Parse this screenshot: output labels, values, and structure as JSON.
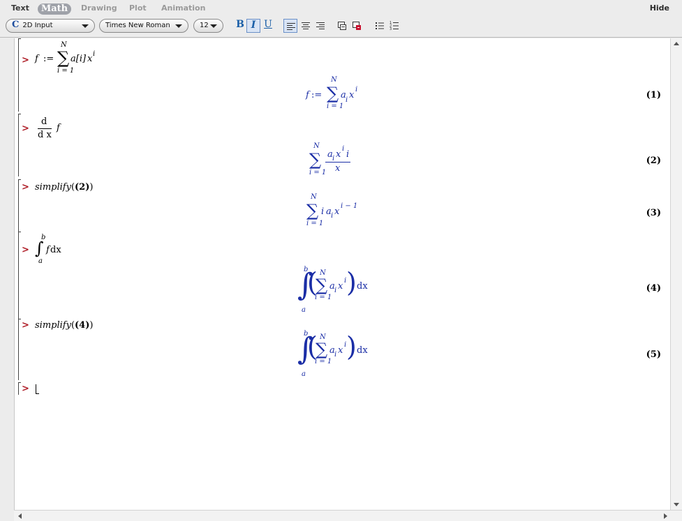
{
  "mode_tabs": {
    "text": "Text",
    "math": "Math",
    "drawing": "Drawing",
    "plot": "Plot",
    "animation": "Animation",
    "hide": "Hide"
  },
  "toolbar": {
    "input_mode": "2D Input",
    "font_family": "Times New Roman",
    "font_size": "12",
    "bold": "B",
    "italic": "I",
    "underline": "U"
  },
  "icons": {
    "input_mode": "math-c-icon",
    "align_left": "align-left-icon",
    "align_center": "align-center-icon",
    "align_right": "align-right-icon",
    "doc1": "insert-region-icon",
    "doc2": "delete-region-icon",
    "bullet_list": "bullet-list-icon",
    "numbered_list": "numbered-list-icon"
  },
  "colors": {
    "prompt": "#b0202a",
    "output_math": "#1b2ea6",
    "active_tab": "#9fa2a9"
  },
  "worksheet": {
    "prompt": ">",
    "groups": [
      {
        "input": {
          "lhs": "f",
          "assign": ":=",
          "sum_top": "N",
          "sum_bottom": "i = 1",
          "body": "a[i]",
          "x": "x",
          "exp": "i"
        },
        "output": {
          "lhs": "f",
          "assign": ":=",
          "sum_top": "N",
          "sum_bottom": "i = 1",
          "a": "a",
          "sub": "i",
          "x": "x",
          "exp": "i"
        },
        "label": "(1)"
      },
      {
        "input": {
          "num": "d",
          "den": "d x",
          "arg": "f"
        },
        "output": {
          "sum_top": "N",
          "sum_bottom": "i = 1",
          "num": "a",
          "sub": "i",
          "x": "x",
          "exp": "i",
          "tail": "i",
          "den": "x"
        },
        "label": "(2)"
      },
      {
        "input": {
          "fn": "simplify",
          "open": "(",
          "ref": "(2)",
          "close": ")"
        },
        "output": {
          "sum_top": "N",
          "sum_bottom": "i = 1",
          "lead": "i",
          "a": "a",
          "sub": "i",
          "x": "x",
          "exp": "i − 1"
        },
        "label": "(3)"
      },
      {
        "input": {
          "upper": "b",
          "lower": "a",
          "integrand": "f",
          "dx": "dx"
        },
        "output": {
          "upper": "b",
          "lower": "a",
          "sum_top": "N",
          "sum_bottom": "i = 1",
          "a": "a",
          "sub": "i",
          "x": "x",
          "exp": "i",
          "dx": "dx"
        },
        "label": "(4)"
      },
      {
        "input": {
          "fn": "simplify",
          "open": "(",
          "ref": "(4)",
          "close": ")"
        },
        "output": {
          "upper": "b",
          "lower": "a",
          "sum_top": "N",
          "sum_bottom": "i = 1",
          "a": "a",
          "sub": "i",
          "x": "x",
          "exp": "i",
          "dx": "dx"
        },
        "label": "(5)"
      }
    ]
  }
}
